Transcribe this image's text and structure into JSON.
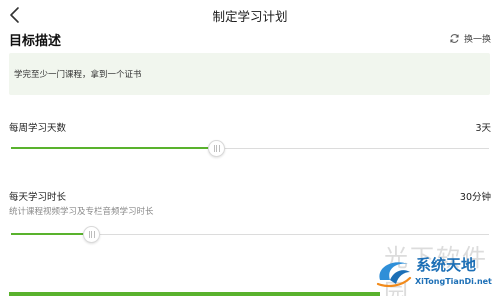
{
  "nav": {
    "back_icon": "chevron-left-icon",
    "title": "制定学习计划"
  },
  "goal": {
    "title": "目标描述",
    "refresh_icon": "refresh-icon",
    "refresh_label": "换一换",
    "text": "学完至少一门课程，拿到一个证书"
  },
  "weekly": {
    "label": "每周学习天数",
    "value": "3天",
    "slider_fraction": 0.428
  },
  "daily": {
    "label": "每天学习时长",
    "value": "30分钟",
    "subtitle": "统计课程视频学习及专栏音频学习时长",
    "slider_fraction": 0.167
  },
  "watermark": {
    "faded_text": "光下软件园",
    "name": "系统天地",
    "site": "XiTongTianDi.net"
  },
  "colors": {
    "accent": "#59b22d",
    "goal_background": "#f1f6ee",
    "watermark_blue": "#1c6fb6"
  }
}
